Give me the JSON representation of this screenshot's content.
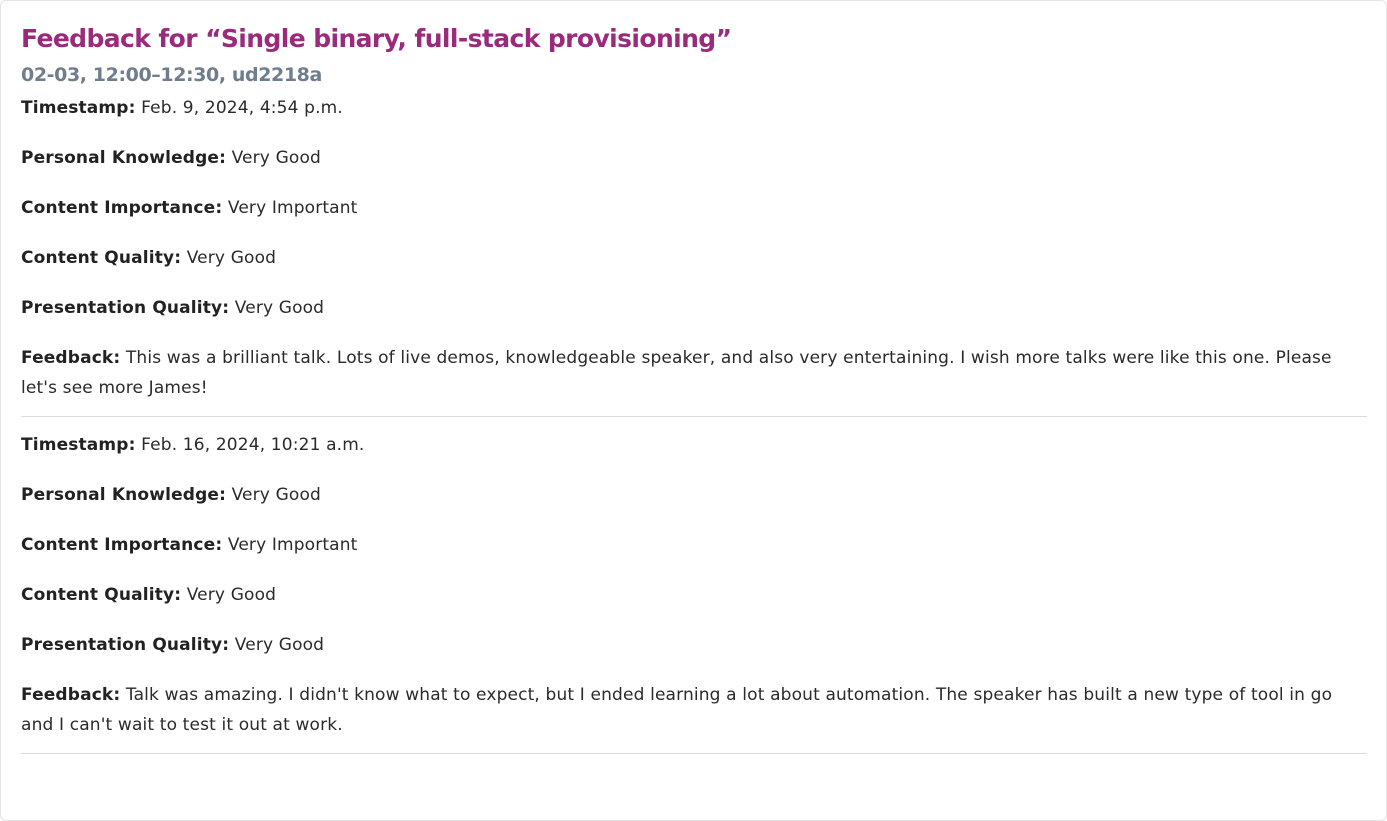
{
  "header": {
    "title": "Feedback for “Single binary, full-stack provisioning”",
    "subtitle": "02-03, 12:00–12:30, ud2218a"
  },
  "labels": {
    "timestamp": "Timestamp:",
    "personal_knowledge": "Personal Knowledge:",
    "content_importance": "Content Importance:",
    "content_quality": "Content Quality:",
    "presentation_quality": "Presentation Quality:",
    "feedback": "Feedback:"
  },
  "entries": [
    {
      "timestamp": "Feb. 9, 2024, 4:54 p.m.",
      "personal_knowledge": "Very Good",
      "content_importance": "Very Important",
      "content_quality": "Very Good",
      "presentation_quality": "Very Good",
      "feedback": "This was a brilliant talk. Lots of live demos, knowledgeable speaker, and also very entertaining. I wish more talks were like this one. Please let's see more James!"
    },
    {
      "timestamp": "Feb. 16, 2024, 10:21 a.m.",
      "personal_knowledge": "Very Good",
      "content_importance": "Very Important",
      "content_quality": "Very Good",
      "presentation_quality": "Very Good",
      "feedback": "Talk was amazing. I didn't know what to expect, but I ended learning a lot about automation. The speaker has built a new type of tool in go and I can't wait to test it out at work."
    }
  ],
  "colors": {
    "title": "#9b2a7c",
    "subtitle": "#6f7d8c",
    "divider": "#dcdcdc"
  }
}
